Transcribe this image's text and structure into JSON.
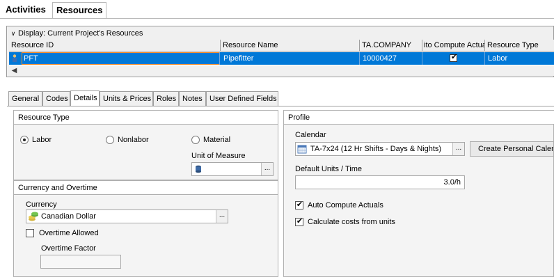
{
  "top_tabs": [
    {
      "label": "Activities",
      "active": false
    },
    {
      "label": "Resources",
      "active": true
    }
  ],
  "display": {
    "label": "Display: Current Project's Resources"
  },
  "grid": {
    "columns": [
      "Resource ID",
      "Resource Name",
      "TA.COMPANY",
      "ito Compute Actua",
      "Resource Type"
    ],
    "rows": [
      {
        "resource_id": "PFT",
        "resource_name": "Pipefitter",
        "company": "10000427",
        "auto_compute_actuals": true,
        "resource_type": "Labor",
        "selected": true
      }
    ]
  },
  "detail_tabs": [
    {
      "label": "General",
      "active": false
    },
    {
      "label": "Codes",
      "active": false
    },
    {
      "label": "Details",
      "active": true
    },
    {
      "label": "Units & Prices",
      "active": false
    },
    {
      "label": "Roles",
      "active": false
    },
    {
      "label": "Notes",
      "active": false
    },
    {
      "label": "User Defined Fields",
      "active": false
    }
  ],
  "resource_type": {
    "title": "Resource Type",
    "options": [
      {
        "label": "Labor",
        "selected": true
      },
      {
        "label": "Nonlabor",
        "selected": false
      },
      {
        "label": "Material",
        "selected": false
      }
    ],
    "unit_of_measure_label": "Unit of Measure",
    "unit_of_measure_value": ""
  },
  "currency_overtime": {
    "title": "Currency and Overtime",
    "currency_label": "Currency",
    "currency_value": "Canadian Dollar",
    "overtime_allowed_label": "Overtime Allowed",
    "overtime_allowed": false,
    "overtime_factor_label": "Overtime Factor",
    "overtime_factor_value": ""
  },
  "profile": {
    "title": "Profile",
    "calendar_label": "Calendar",
    "calendar_value": "TA-7x24 (12 Hr Shifts - Days & Nights)",
    "create_calendar_button": "Create Personal Calendar",
    "default_units_label": "Default Units / Time",
    "default_units_value": "3.0/h",
    "auto_compute_label": "Auto Compute Actuals",
    "auto_compute": true,
    "calc_costs_label": "Calculate costs from units",
    "calc_costs": true
  },
  "ellipsis": "...",
  "check_glyph": "✔",
  "colors": {
    "selection": "#0078d7",
    "accent_border": "#f08a24"
  }
}
